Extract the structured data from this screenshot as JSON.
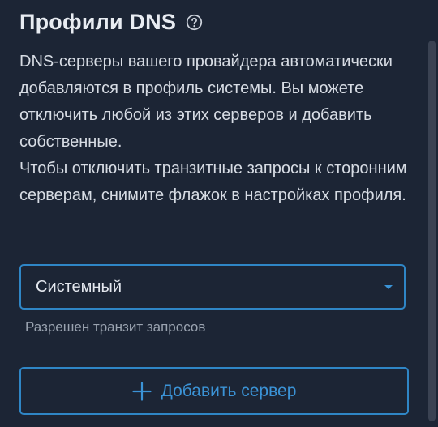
{
  "header": {
    "title": "Профили DNS",
    "help_icon": "help-circle-icon"
  },
  "description": {
    "paragraph_1": "DNS-серверы вашего провайдера автоматически добавляются в профиль системы. Вы можете отключить любой из этих серверов и добавить собственные.",
    "paragraph_2": "Чтобы отключить транзитные запросы к сторонним серверам, снимите флажок в настройках профиля."
  },
  "profile_select": {
    "selected_value": "Системный",
    "arrow_icon": "caret-down-icon"
  },
  "helper_text": "Разрешен транзит запросов",
  "add_server": {
    "label": "Добавить сервер",
    "icon": "plus-icon"
  },
  "colors": {
    "background": "#1c2535",
    "accent": "#3b93d6",
    "border": "#2f86c6",
    "text_primary": "#e8ecf2",
    "text_secondary": "#9aa3b0"
  }
}
